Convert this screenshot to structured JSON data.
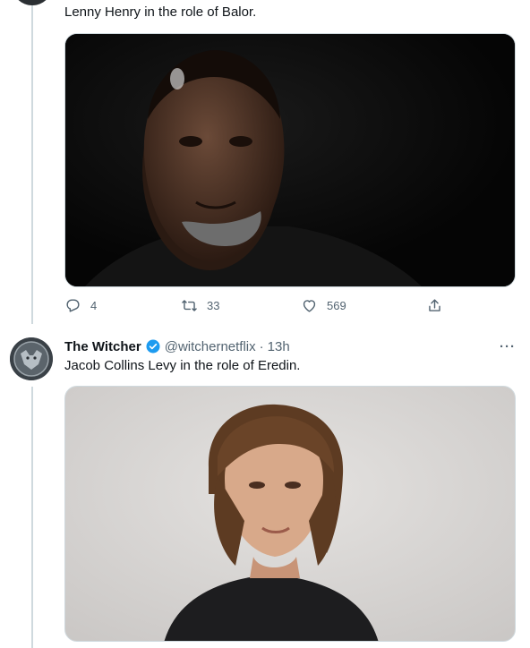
{
  "tweet1": {
    "text": "Lenny Henry in the role of Balor.",
    "image_alt": "Portrait of Lenny Henry",
    "actions": {
      "replies": "4",
      "retweets": "33",
      "likes": "569"
    }
  },
  "tweet2": {
    "name": "The Witcher",
    "handle": "@witchernetflix",
    "separator": "·",
    "time": "13h",
    "text": "Jacob Collins Levy in the role of Eredin.",
    "image_alt": "Portrait of Jacob Collins Levy",
    "more_label": "···"
  },
  "colors": {
    "verified": "#1d9bf0",
    "muted": "#536471",
    "thread_line": "#cfd9de"
  }
}
